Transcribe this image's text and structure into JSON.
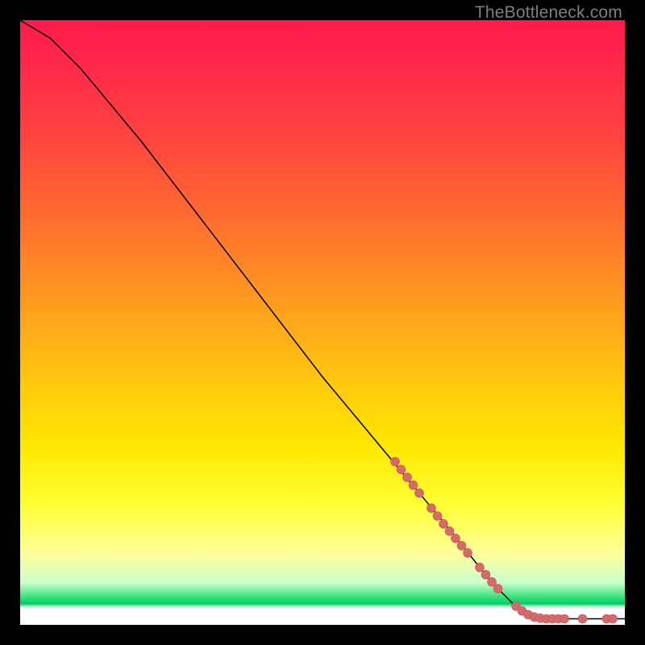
{
  "watermark": "TheBottleneck.com",
  "colors": {
    "marker_fill": "#d66a6a",
    "marker_stroke": "#c05858",
    "curve": "#000000"
  },
  "chart_data": {
    "type": "line",
    "title": "",
    "xlabel": "",
    "ylabel": "",
    "xlim": [
      0,
      100
    ],
    "ylim": [
      0,
      100
    ],
    "curve": [
      {
        "x": 0,
        "y": 100
      },
      {
        "x": 5,
        "y": 97
      },
      {
        "x": 10,
        "y": 92
      },
      {
        "x": 15,
        "y": 86
      },
      {
        "x": 20,
        "y": 80
      },
      {
        "x": 30,
        "y": 67
      },
      {
        "x": 40,
        "y": 54
      },
      {
        "x": 50,
        "y": 41
      },
      {
        "x": 60,
        "y": 29
      },
      {
        "x": 70,
        "y": 17
      },
      {
        "x": 78,
        "y": 7
      },
      {
        "x": 82,
        "y": 3
      },
      {
        "x": 86,
        "y": 1
      },
      {
        "x": 90,
        "y": 1
      },
      {
        "x": 100,
        "y": 1
      }
    ],
    "markers": [
      {
        "x": 62,
        "y": 27
      },
      {
        "x": 63,
        "y": 25.7
      },
      {
        "x": 64,
        "y": 24.4
      },
      {
        "x": 65,
        "y": 23.1
      },
      {
        "x": 66,
        "y": 21.8
      },
      {
        "x": 68,
        "y": 19.3
      },
      {
        "x": 69,
        "y": 18.0
      },
      {
        "x": 70,
        "y": 16.7
      },
      {
        "x": 71,
        "y": 15.5
      },
      {
        "x": 72,
        "y": 14.3
      },
      {
        "x": 73,
        "y": 13.1
      },
      {
        "x": 74,
        "y": 11.9
      },
      {
        "x": 76,
        "y": 9.5
      },
      {
        "x": 77,
        "y": 8.3
      },
      {
        "x": 78,
        "y": 7.1
      },
      {
        "x": 79,
        "y": 6.0
      },
      {
        "x": 82,
        "y": 3.1
      },
      {
        "x": 83,
        "y": 2.3
      },
      {
        "x": 84,
        "y": 1.7
      },
      {
        "x": 85,
        "y": 1.3
      },
      {
        "x": 86,
        "y": 1.1
      },
      {
        "x": 87,
        "y": 1
      },
      {
        "x": 88,
        "y": 1
      },
      {
        "x": 89,
        "y": 1
      },
      {
        "x": 90,
        "y": 1
      },
      {
        "x": 93,
        "y": 1
      },
      {
        "x": 97,
        "y": 1
      },
      {
        "x": 98,
        "y": 1
      }
    ],
    "marker_radius": 5.5
  }
}
